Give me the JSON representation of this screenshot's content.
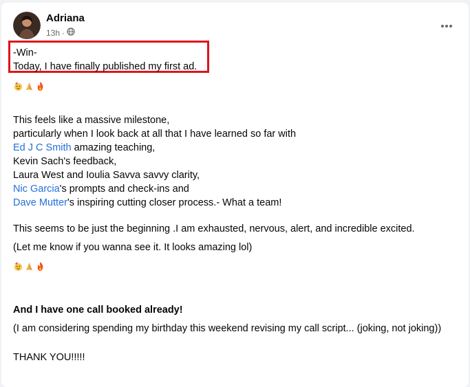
{
  "post": {
    "author": "Adriana",
    "time": "13h",
    "dot": "·",
    "lines": {
      "win": "-Win-",
      "published": "Today, I have finally published my first ad.",
      "milestone": "This feels like a massive milestone,",
      "learned": "particularly when I look back at all that I have learned so far with",
      "ed_name": "Ed J C Smith",
      "ed_rest": " amazing teaching,",
      "kevin": "Kevin Sach's feedback,",
      "laura": "Laura West and Ioulia Savva savvy clarity,",
      "nic_name": "Nic Garcia",
      "nic_rest": "'s prompts and check-ins and",
      "dave_name": "Dave Mutter",
      "dave_rest": "'s inspiring cutting closer process.- What a team!",
      "beginning": "This seems to be just the beginning .I am exhausted, nervous, alert, and incredible excited.",
      "seeit": "(Let me know if you wanna see it. It looks amazing lol)",
      "booked": "And I have one call booked already!",
      "birthday": "(I am considering spending my birthday this weekend revising my call script... (joking, not joking))",
      "thanks": "THANK YOU!!!!!"
    }
  },
  "icons": {
    "privacy": "globe-icon",
    "more": "more-options-icon",
    "emoji": [
      "party-face-icon",
      "folded-hands-icon",
      "fire-icon"
    ]
  },
  "colors": {
    "link": "#216fdb",
    "highlight_border": "#e0131b",
    "secondary_text": "#65676b"
  }
}
